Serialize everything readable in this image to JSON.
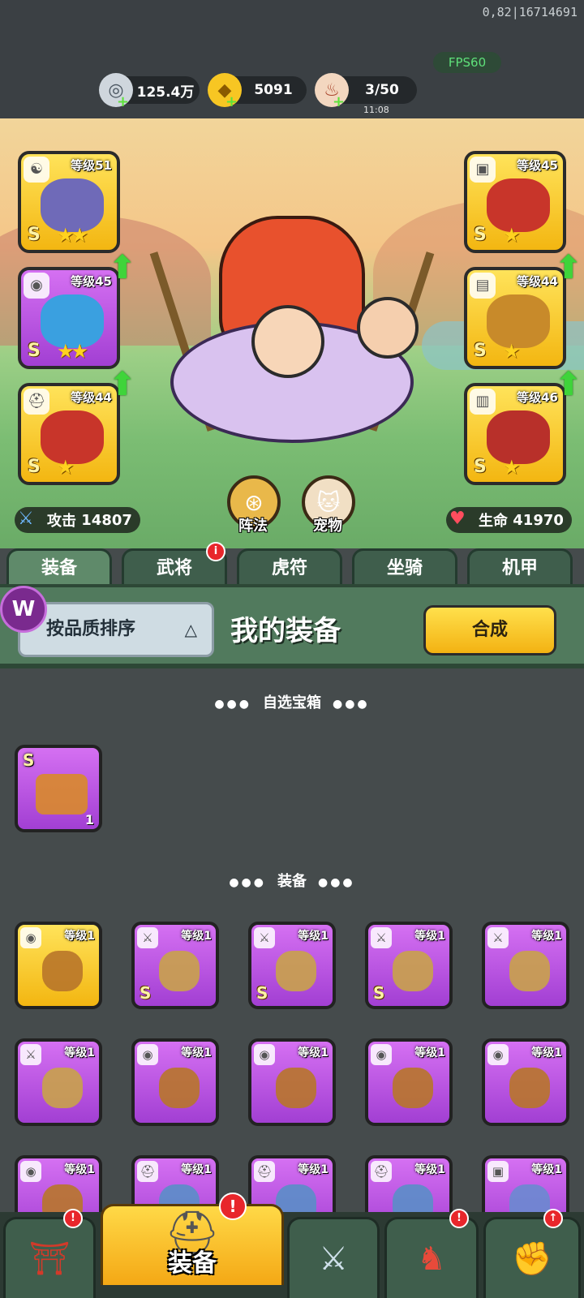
{
  "debug_text": "0,82|16714691",
  "fps": "FPS60",
  "resources": {
    "silver": {
      "value": "125.4万",
      "icon": "silver-coin-icon"
    },
    "gold": {
      "value": "5091",
      "icon": "gold-ingot-icon"
    },
    "stamina": {
      "value": "3/50",
      "timer": "11:08",
      "icon": "meat-icon"
    }
  },
  "equipped": {
    "weapon": {
      "level": "等级51",
      "rank": "S",
      "stars": "★★",
      "slot_icon": "yin-yang-icon"
    },
    "medal": {
      "level": "等级45",
      "rank": "S",
      "stars": "★★",
      "slot_icon": "medal-icon"
    },
    "helmet": {
      "level": "等级44",
      "rank": "S",
      "stars": "★",
      "slot_icon": "helmet-icon"
    },
    "armor": {
      "level": "等级45",
      "rank": "S",
      "stars": "★",
      "slot_icon": "armor-icon"
    },
    "bracer": {
      "level": "等级44",
      "rank": "S",
      "stars": "★",
      "slot_icon": "bracer-icon"
    },
    "boots": {
      "level": "等级46",
      "rank": "S",
      "stars": "★",
      "slot_icon": "boot-icon"
    }
  },
  "formation_label": "阵法",
  "pet_label": "宠物",
  "attack": {
    "label": "攻击",
    "value": "14807"
  },
  "hp": {
    "label": "生命",
    "value": "41970"
  },
  "tabs": [
    {
      "label": "装备"
    },
    {
      "label": "武将",
      "badge": "i"
    },
    {
      "label": "虎符"
    },
    {
      "label": "坐骑"
    },
    {
      "label": "机甲"
    }
  ],
  "sort_label": "按品质排序",
  "panel_title": "我的装备",
  "synth_label": "合成",
  "section_chest": "自选宝箱",
  "section_equip": "装备",
  "chest": {
    "rank": "S",
    "qty": "1"
  },
  "items": [
    {
      "level": "等级1",
      "rank": "",
      "quality": "gold",
      "slot_icon": "medal-icon"
    },
    {
      "level": "等级1",
      "rank": "S",
      "quality": "purple",
      "slot_icon": "sword-icon"
    },
    {
      "level": "等级1",
      "rank": "S",
      "quality": "purple",
      "slot_icon": "sword-icon"
    },
    {
      "level": "等级1",
      "rank": "S",
      "quality": "purple",
      "slot_icon": "sword-icon"
    },
    {
      "level": "等级1",
      "rank": "",
      "quality": "purple",
      "slot_icon": "sword-icon"
    },
    {
      "level": "等级1",
      "rank": "",
      "quality": "purple",
      "slot_icon": "sword-icon"
    },
    {
      "level": "等级1",
      "rank": "",
      "quality": "purple",
      "slot_icon": "medal-icon"
    },
    {
      "level": "等级1",
      "rank": "",
      "quality": "purple",
      "slot_icon": "medal-icon"
    },
    {
      "level": "等级1",
      "rank": "",
      "quality": "purple",
      "slot_icon": "medal-icon"
    },
    {
      "level": "等级1",
      "rank": "",
      "quality": "purple",
      "slot_icon": "medal-icon"
    },
    {
      "level": "等级1",
      "rank": "",
      "quality": "purple",
      "slot_icon": "medal-icon"
    },
    {
      "level": "等级1",
      "rank": "",
      "quality": "purple",
      "slot_icon": "helmet-icon"
    },
    {
      "level": "等级1",
      "rank": "",
      "quality": "purple",
      "slot_icon": "helmet-icon"
    },
    {
      "level": "等级1",
      "rank": "",
      "quality": "purple",
      "slot_icon": "helmet-icon"
    },
    {
      "level": "等级1",
      "rank": "",
      "quality": "purple",
      "slot_icon": "armor-icon"
    }
  ],
  "bottom_nav": [
    {
      "icon": "shop-gate-icon",
      "badge": "!"
    },
    {
      "label": "装备",
      "icon": "helmet-icon",
      "badge": "!"
    },
    {
      "icon": "crossed-swords-icon"
    },
    {
      "icon": "rooster-icon",
      "badge": "!"
    },
    {
      "icon": "power-fist-icon",
      "badge": "↑"
    }
  ]
}
